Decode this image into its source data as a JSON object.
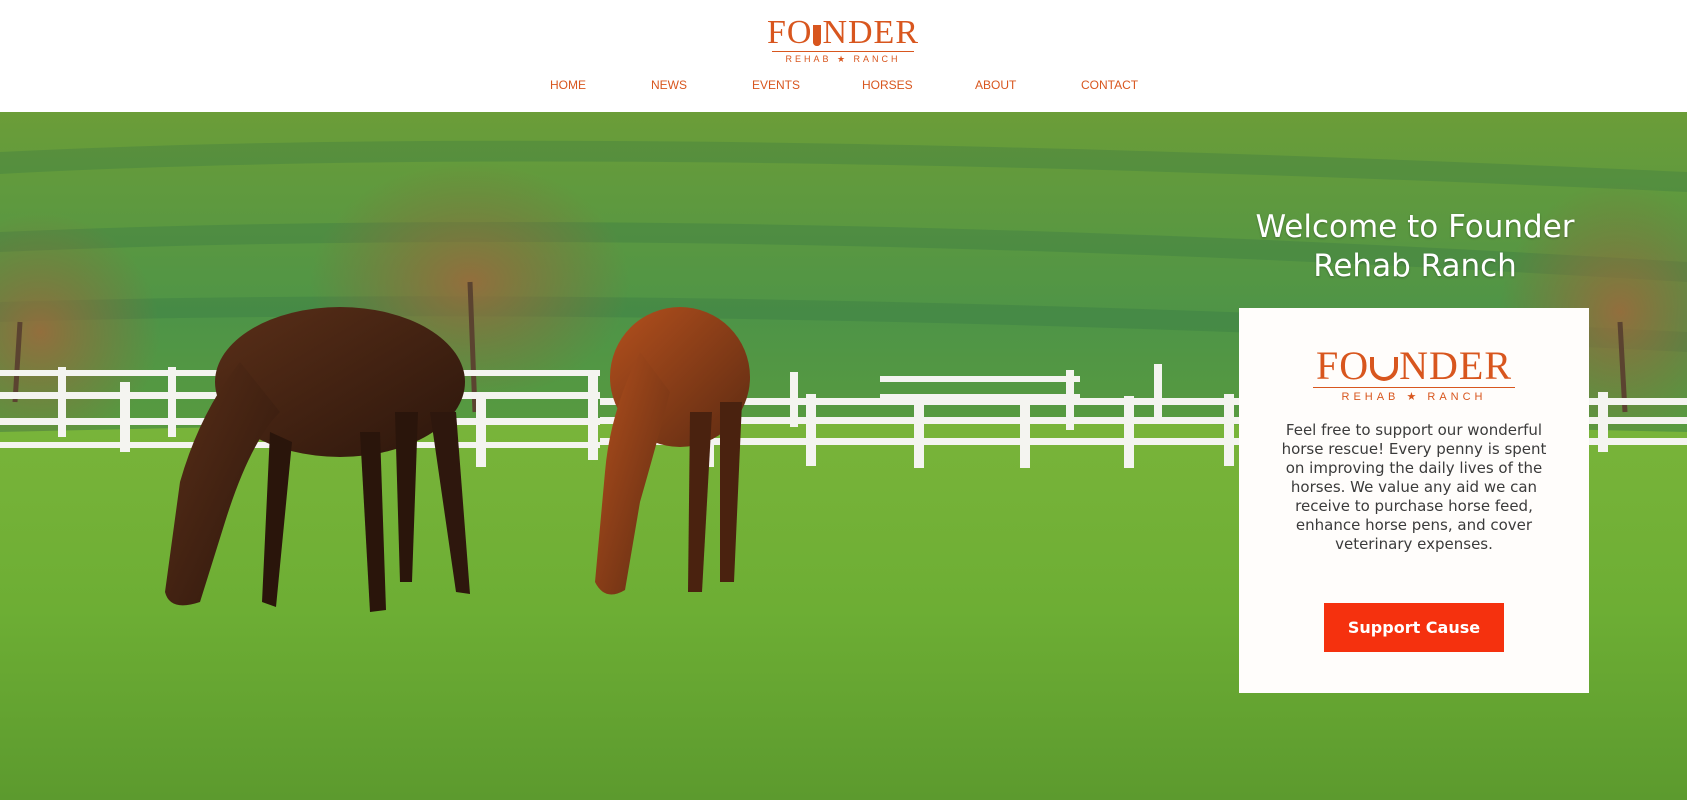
{
  "brand": {
    "name_start": "FO",
    "name_end": "NDER",
    "subtitle": "REHAB ★ RANCH",
    "color": "#d8561e"
  },
  "nav": {
    "items": [
      {
        "label": "HOME"
      },
      {
        "label": "NEWS"
      },
      {
        "label": "EVENTS"
      },
      {
        "label": "HORSES"
      },
      {
        "label": "ABOUT"
      },
      {
        "label": "CONTACT"
      }
    ]
  },
  "hero": {
    "heading": "Welcome to Founder Rehab Ranch",
    "card": {
      "text": "Feel free to support our wonderful horse rescue! Every penny is spent on improving the daily lives of the horses. We value any aid we can receive to purchase horse feed, enhance horse pens, and cover veterinary expenses.",
      "button_label": "Support Cause",
      "button_color": "#f5310e"
    }
  }
}
